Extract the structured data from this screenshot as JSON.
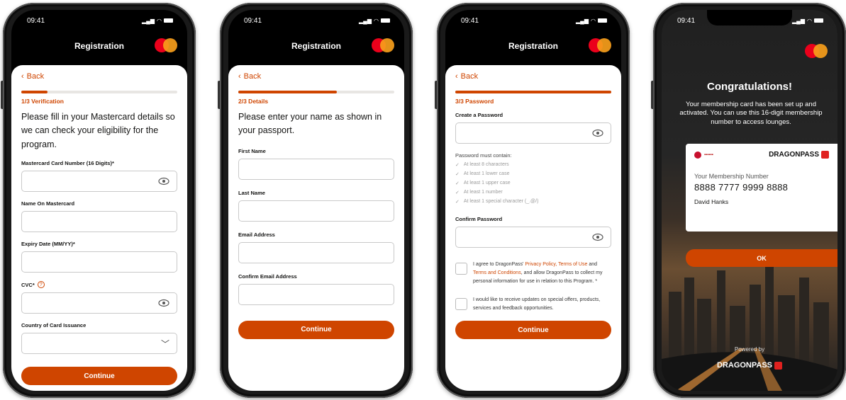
{
  "status_time": "09:41",
  "registration_title": "Registration",
  "back_label": "Back",
  "continue_label": "Continue",
  "brand": {
    "accent": "#cf4500",
    "mastercard_red": "#eb001b",
    "mastercard_yellow": "#f79e1b"
  },
  "screen1": {
    "step": "1/3 Verification",
    "progress": 0.17,
    "intro": "Please fill in your Mastercard details so we can check your eligibility for the program.",
    "fields": {
      "card_number": "Mastercard Card Number (16 Digits)*",
      "name": "Name On Mastercard",
      "expiry": "Expiry Date (MM/YY)*",
      "cvc": "CVC*",
      "country": "Country of Card Issuance"
    }
  },
  "screen2": {
    "step": "2/3 Details",
    "progress": 0.63,
    "intro": "Please enter your name as shown in your passport.",
    "fields": {
      "first_name": "First Name",
      "last_name": "Last Name",
      "email": "Email Address",
      "confirm_email": "Confirm Email Address"
    }
  },
  "screen3": {
    "step": "3/3 Password",
    "progress": 1.0,
    "create_password": "Create a Password",
    "requirements_title": "Password must contain:",
    "requirements": [
      "At least 8 characters",
      "At least 1 lower case",
      "At least 1 upper case",
      "At least 1 number",
      "At least 1 special character (_.@/)"
    ],
    "confirm_password": "Confirm Password",
    "consent1": {
      "pre": "I agree to DragonPass' ",
      "link1": "Privacy Policy, Terms of Use",
      "mid": " and ",
      "link2": "Terms and Conditions",
      "post": ", and allow DragonPass to collect my personal information for use in relation to this Program. *"
    },
    "consent2": "I would like to receive updates on special offers, products, services and feedback opportunities."
  },
  "screen4": {
    "title": "Congratulations!",
    "body": "Your membership card has been set up and activated. You can use this 16-digit membership number to access lounges.",
    "card_label": "Your Membership Number",
    "card_number": "8888 7777 9999 8888",
    "card_name": "David Hanks",
    "dragonpass": "DRAGONPASS",
    "ok_label": "OK",
    "powered_by": "Powered by"
  }
}
